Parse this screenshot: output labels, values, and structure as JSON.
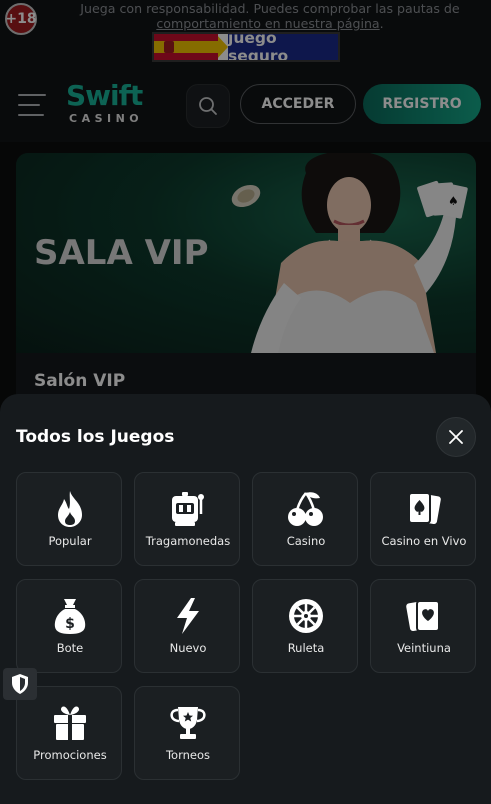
{
  "responsible_bar": {
    "age_badge": "+18",
    "text_plain": "Juega con responsabilidad. Puedes comprobar las pautas de ",
    "text_link": "comportamiento en nuestra página",
    "text_end": ".",
    "juego_seguro": "juego seguro"
  },
  "header": {
    "logo_top": "Swift",
    "logo_bottom": "CASINO",
    "login_label": "ACCEDER",
    "register_label": "REGISTRO"
  },
  "vip_card": {
    "banner_title": "SALA VIP",
    "label": "Salón VIP"
  },
  "sheet": {
    "title": "Todos los Juegos",
    "categories": [
      {
        "label": "Popular",
        "icon": "fire-icon"
      },
      {
        "label": "Tragamonedas",
        "icon": "slot-machine-icon"
      },
      {
        "label": "Casino",
        "icon": "cherries-icon"
      },
      {
        "label": "Casino en Vivo",
        "icon": "cards-icon"
      },
      {
        "label": "Bote",
        "icon": "money-bag-icon"
      },
      {
        "label": "Nuevo",
        "icon": "lightning-icon"
      },
      {
        "label": "Ruleta",
        "icon": "roulette-icon"
      },
      {
        "label": "Veintiuna",
        "icon": "blackjack-cards-icon"
      },
      {
        "label": "Promociones",
        "icon": "gift-icon"
      },
      {
        "label": "Torneos",
        "icon": "trophy-icon"
      }
    ]
  },
  "colors": {
    "accent": "#15a889",
    "background": "#0b0d0e",
    "sheet": "#161a1d",
    "tile": "#1b1f22"
  }
}
